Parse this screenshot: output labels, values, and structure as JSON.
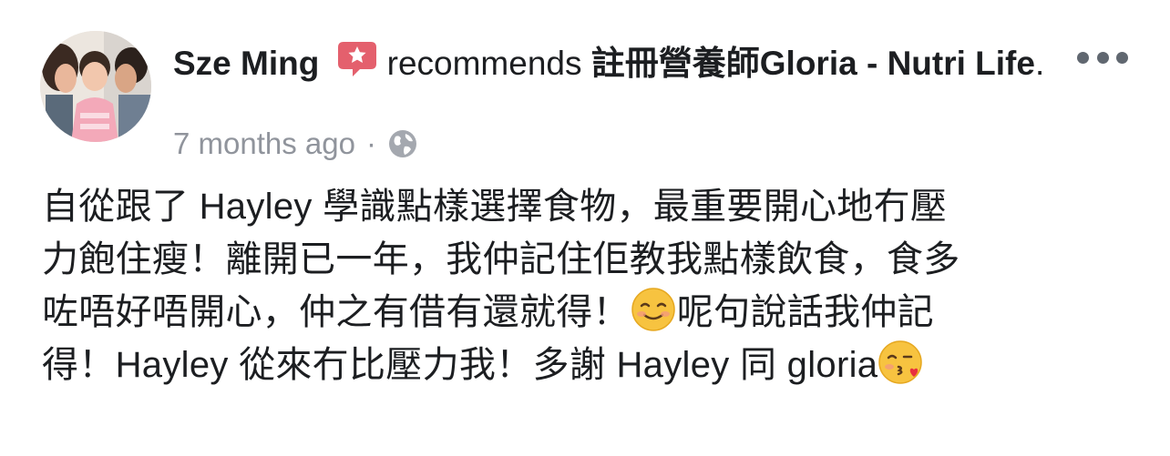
{
  "post": {
    "author_name": "Sze Ming",
    "action_verb": "recommends",
    "page_name": "註冊營養師Gloria - Nutri Life",
    "trailing_period": ".",
    "timestamp": "7 months ago",
    "separator": "·",
    "privacy_icon": "globe-icon",
    "recommend_icon": "speech-bubble-star-icon",
    "more_icon": "ellipsis-icon",
    "accent_color": "#e4606d",
    "body_lines": [
      "自從跟了 Hayley 學識點樣選擇食物，最重要開心地冇壓",
      "力飽住瘦！離開已一年，我仲記住佢教我點樣飲食，食多",
      "咗唔好唔開心，仲之有借有還就得！",
      "呢句說話我仲記",
      "得！Hayley 從來冇比壓力我！多謝 Hayley 同 gloria"
    ],
    "emojis": [
      "smiling-face-emoji",
      "face-blowing-kiss-emoji"
    ]
  }
}
